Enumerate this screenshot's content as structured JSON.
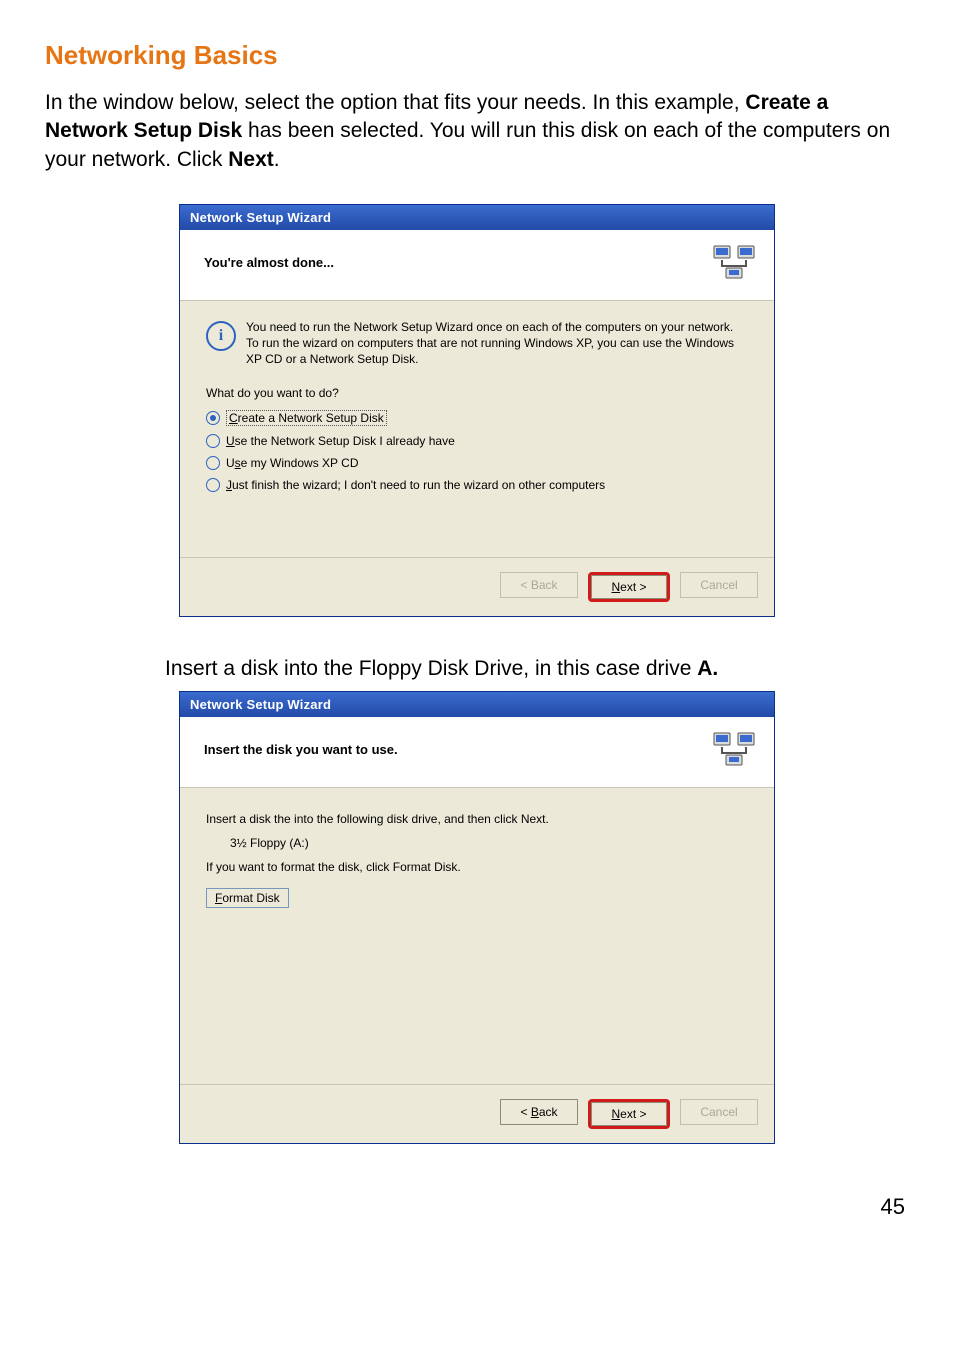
{
  "page": {
    "title": "Networking Basics",
    "intro_plain1": "In the window below, select the option that fits your needs.  In this example, ",
    "intro_bold1": "Create a Network Setup Disk",
    "intro_plain2": " has been selected.  You will run this disk on each of the computers on your network.  Click ",
    "intro_bold2": "Next",
    "intro_plain3": ".",
    "caption2_plain": "Insert a disk into the Floppy Disk Drive, in this case drive ",
    "caption2_bold": "A.",
    "number": "45"
  },
  "wizard1": {
    "title": "Network Setup Wizard",
    "heading": "You're almost done...",
    "info": "You need to run the Network Setup Wizard once on each of the computers on your network. To run the wizard on computers that are not running Windows XP, you can use the Windows XP CD or a Network Setup Disk.",
    "question": "What do you want to do?",
    "options": [
      {
        "label_pre": "C",
        "label_rest": "reate a Network Setup Disk",
        "selected": true
      },
      {
        "label_pre": "U",
        "label_rest": "se the Network Setup Disk I already have",
        "selected": false
      },
      {
        "label_pre": "",
        "label_rest": "Use my Windows XP CD",
        "u_part": "s",
        "prefix": "U",
        "selected": false,
        "alt": true
      },
      {
        "label_pre": "J",
        "label_rest": "ust finish the wizard; I don't need to run the wizard on other computers",
        "selected": false
      }
    ],
    "buttons": {
      "back": "< Back",
      "next_pre": "N",
      "next_rest": "ext >",
      "cancel": "Cancel"
    }
  },
  "wizard2": {
    "title": "Network Setup Wizard",
    "heading": "Insert the disk you want to use.",
    "line1": "Insert a disk the into the following disk drive, and then click Next.",
    "drive": "3½ Floppy (A:)",
    "line2": "If you want to format the disk, click Format Disk.",
    "format_pre": "F",
    "format_rest": "ormat Disk",
    "buttons": {
      "back_pre": "B",
      "back_rest": "ack",
      "back_prefix": "< ",
      "next_pre": "N",
      "next_rest": "ext >",
      "cancel": "Cancel"
    }
  }
}
